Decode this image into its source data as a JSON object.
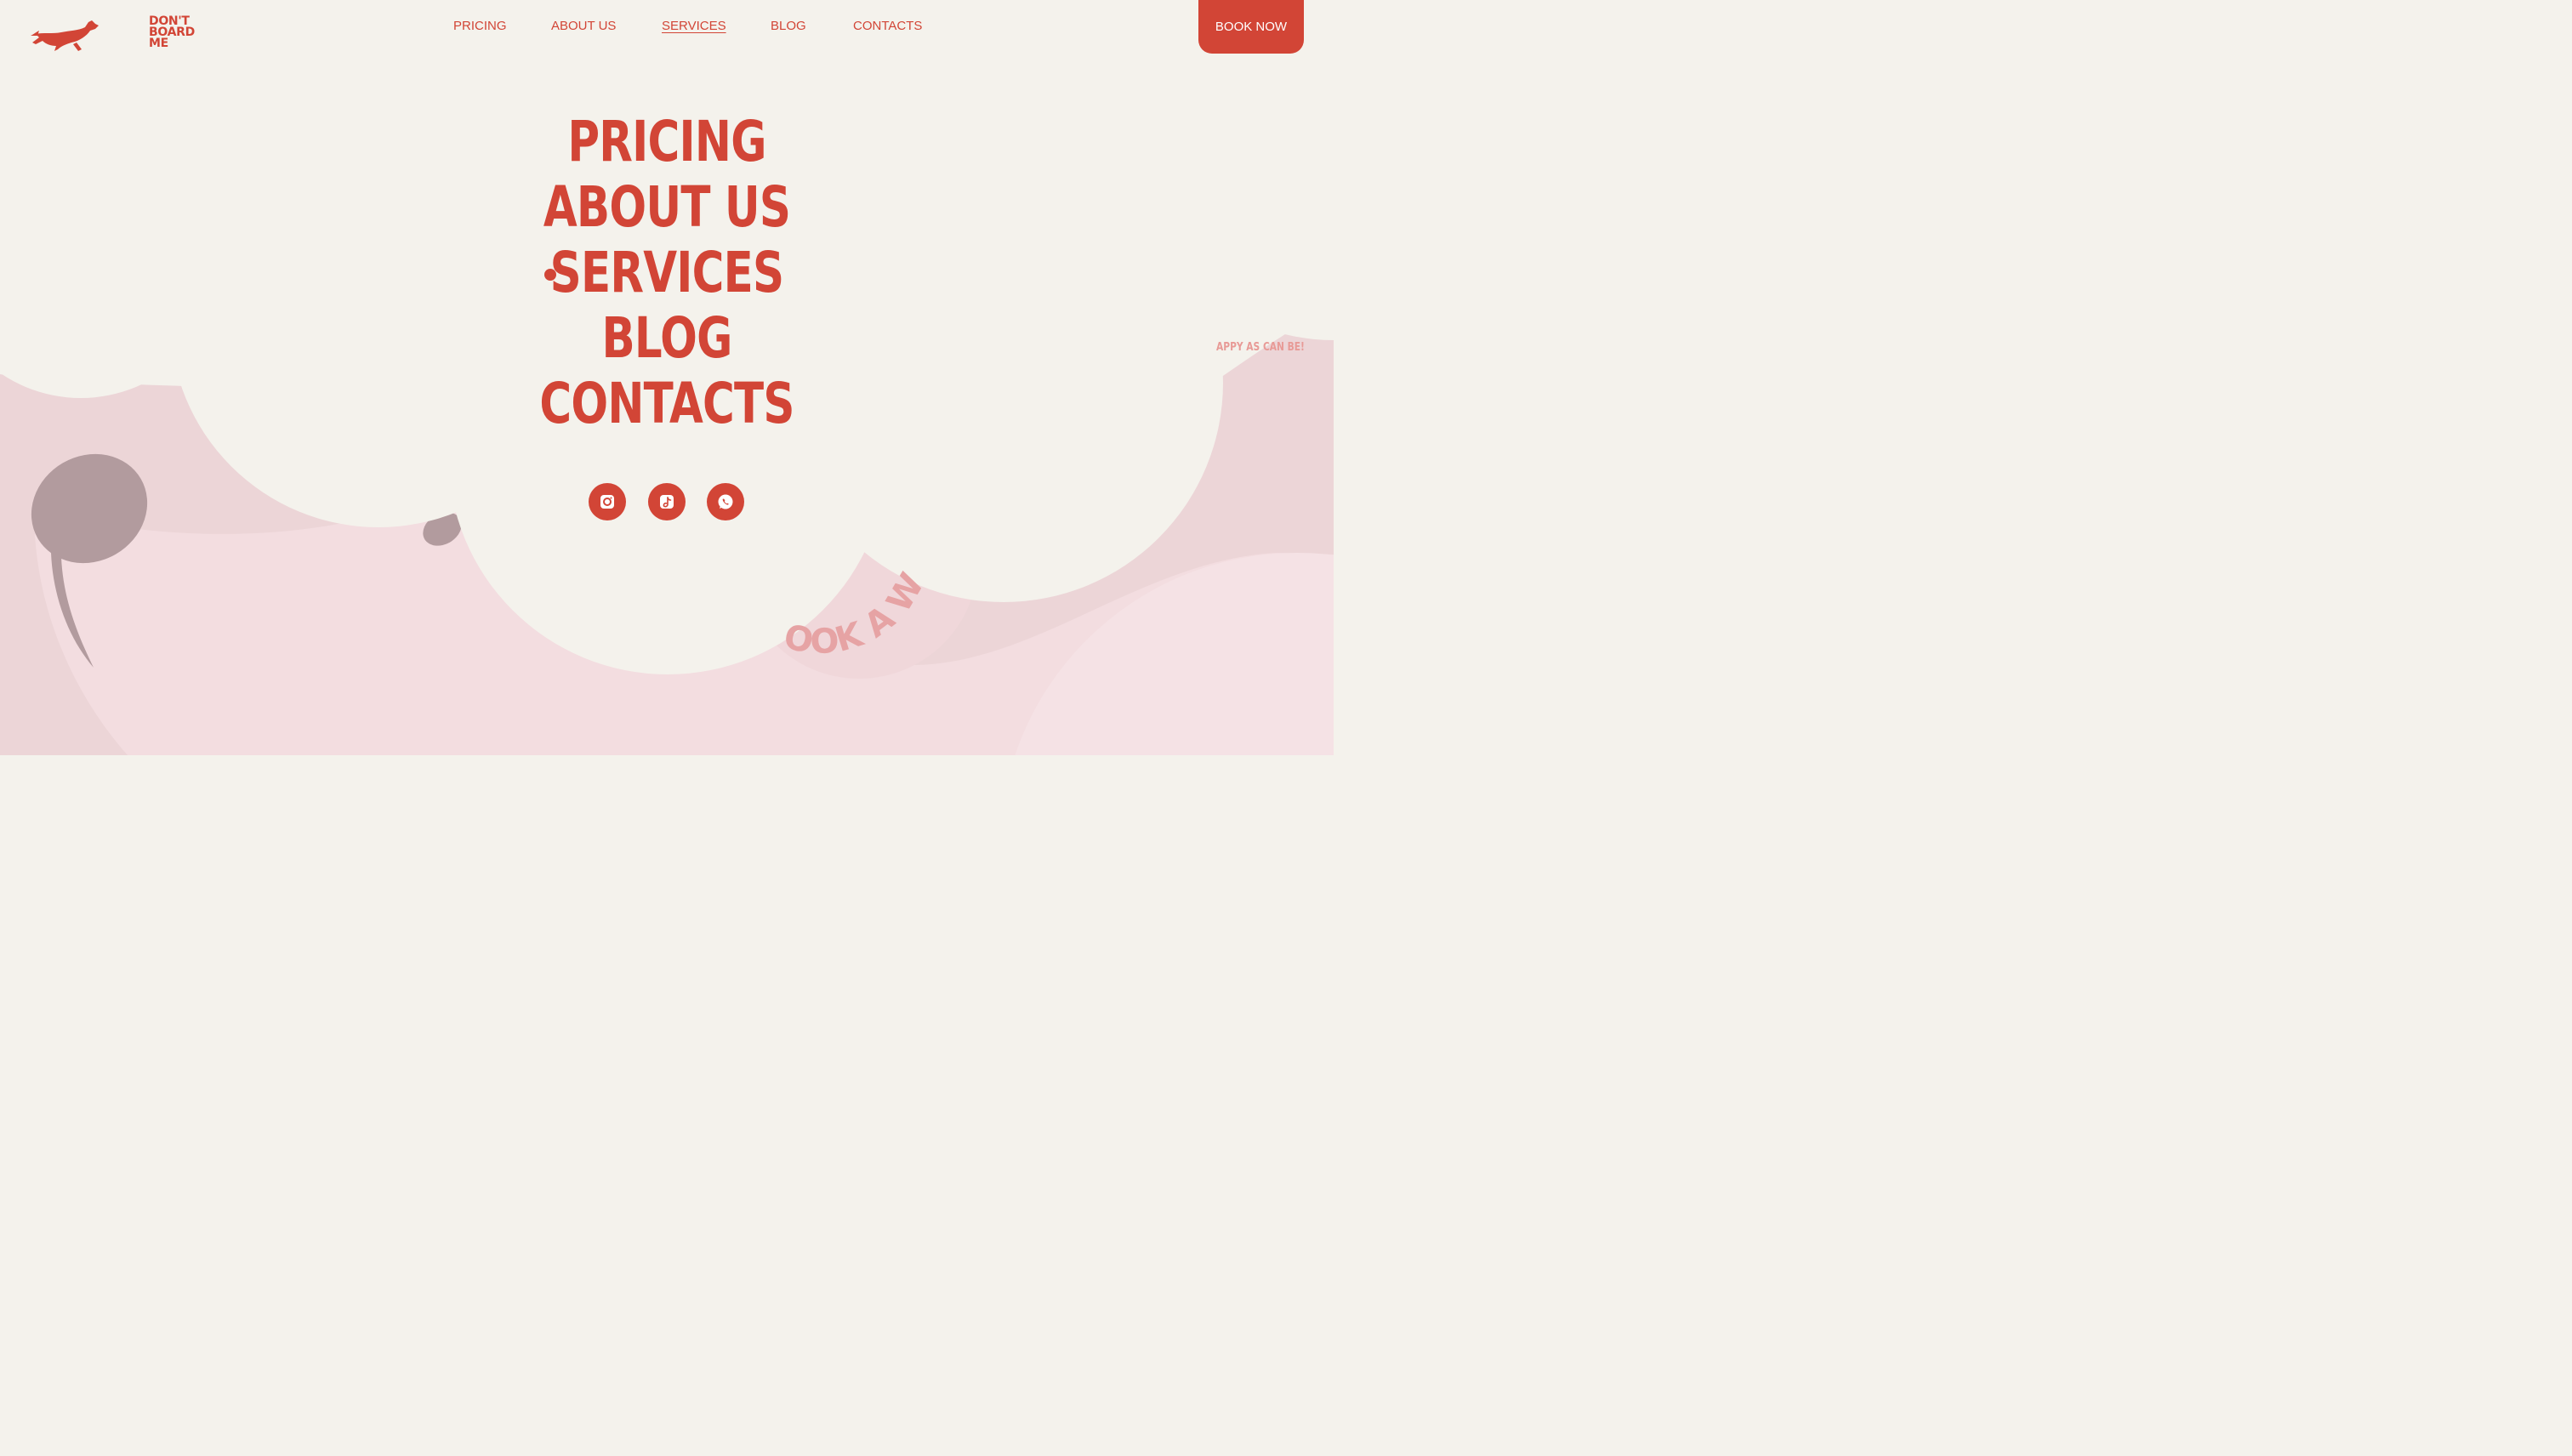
{
  "brand": {
    "logo_lines": [
      "DON'T",
      "BOARD",
      "ME"
    ],
    "logo_icon": "running-dachshund-icon",
    "accent_color": "#d24536",
    "background_color": "#f4f2ec",
    "pink_color": "#f2dcdf"
  },
  "nav": {
    "items": [
      {
        "label": "PRICING"
      },
      {
        "label": "ABOUT US"
      },
      {
        "label": "SERVICES",
        "active": true
      },
      {
        "label": "BLOG"
      },
      {
        "label": "CONTACTS"
      }
    ],
    "book_label": "BOOK NOW"
  },
  "menu": {
    "items": [
      {
        "label": "PRICING"
      },
      {
        "label": "ABOUT US"
      },
      {
        "label": "SERVICES",
        "active": true
      },
      {
        "label": "BLOG"
      },
      {
        "label": "CONTACTS"
      }
    ]
  },
  "socials": [
    {
      "icon": "instagram-icon"
    },
    {
      "icon": "tiktok-icon"
    },
    {
      "icon": "whatsapp-icon"
    }
  ],
  "decor": {
    "tagline": "APPY AS CAN BE!",
    "curved_text": "OOK A W"
  }
}
